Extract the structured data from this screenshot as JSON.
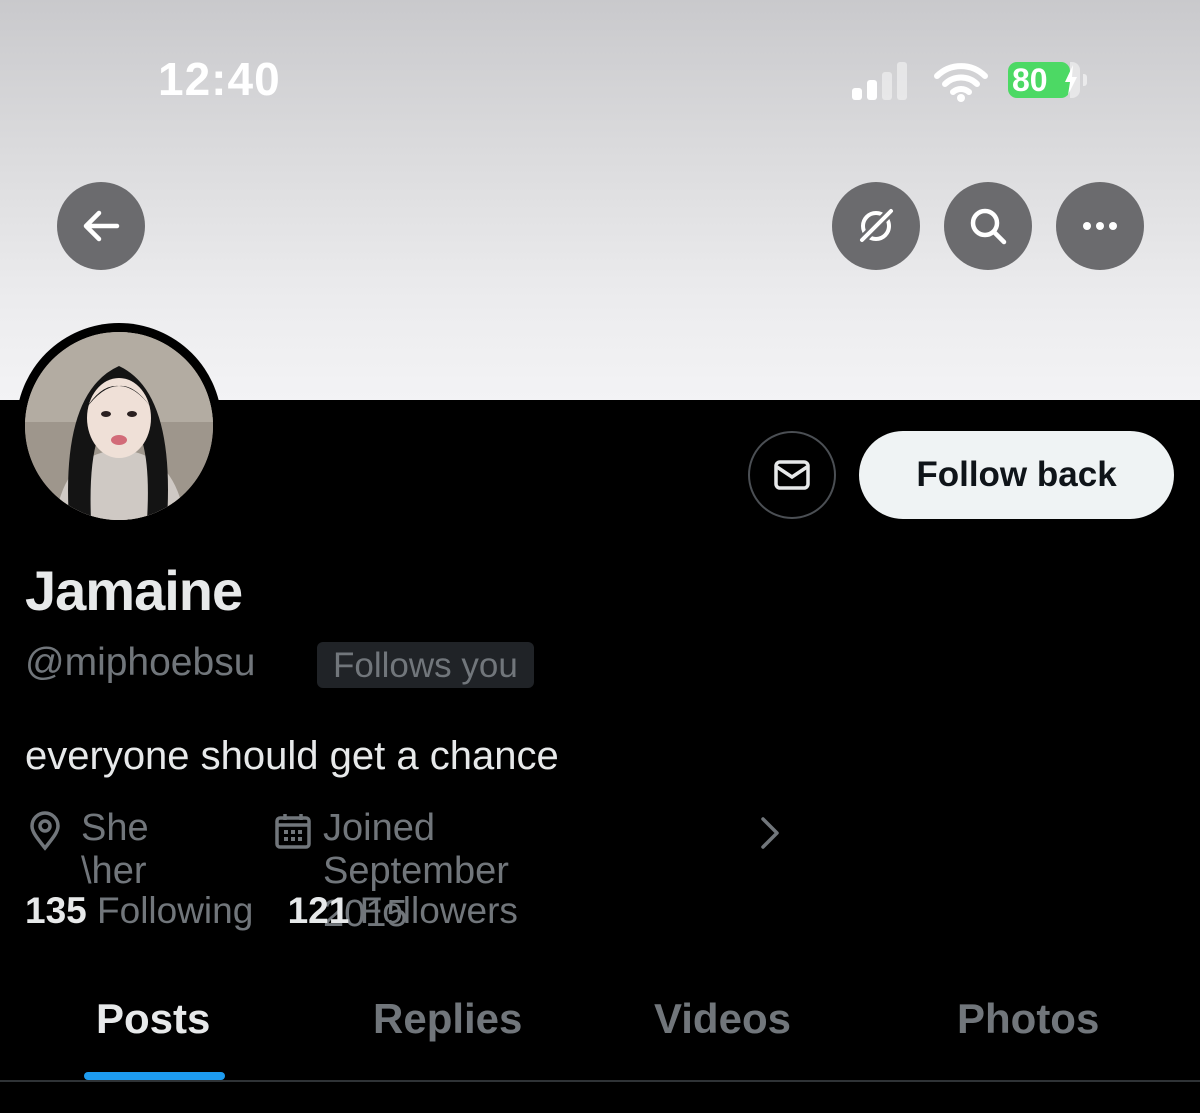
{
  "status_bar": {
    "time": "12:40",
    "battery_level": "80",
    "battery_color": "#4cd964",
    "signal_bars_active": 2,
    "signal_bars_total": 4
  },
  "nav": {
    "back_icon": "arrow-left-icon",
    "grok_icon": "grok-icon",
    "search_icon": "search-icon",
    "more_icon": "more-horizontal-icon"
  },
  "profile": {
    "display_name": "Jamaine",
    "handle": "@miphoebsu",
    "follows_you": "Follows you",
    "bio": "everyone should get a chance",
    "location": "She \\her",
    "joined": "Joined September 2015",
    "following_count": "135",
    "following_label": "Following",
    "followers_count": "121",
    "followers_label": "Followers"
  },
  "actions": {
    "message_icon": "envelope-icon",
    "follow_back_label": "Follow back"
  },
  "tabs": [
    {
      "label": "Posts",
      "active": true
    },
    {
      "label": "Replies",
      "active": false
    },
    {
      "label": "Videos",
      "active": false
    },
    {
      "label": "Photos",
      "active": false
    }
  ],
  "colors": {
    "accent": "#1d9bf0",
    "background": "#000000",
    "primary_text": "#e7e9ea",
    "secondary_text": "#71767b"
  }
}
